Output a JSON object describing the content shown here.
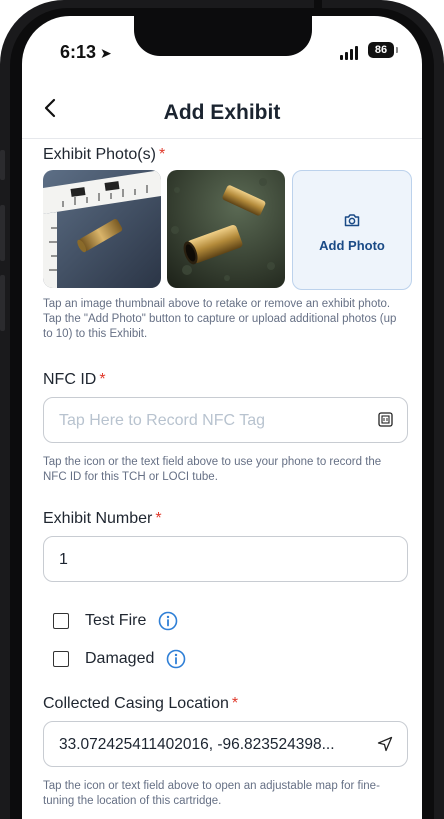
{
  "status": {
    "time": "6:13",
    "battery": "86"
  },
  "header": {
    "title": "Add Exhibit",
    "back_icon": "chevron-left-icon"
  },
  "photos": {
    "label": "Exhibit Photo(s)",
    "required_mark": "*",
    "add_label": "Add Photo",
    "help": "Tap an image thumbnail above to retake or remove an exhibit photo. Tap the \"Add Photo\" button to capture or upload additional photos (up to 10) to this Exhibit."
  },
  "nfc": {
    "label": "NFC ID",
    "required_mark": "*",
    "placeholder": "Tap Here to Record NFC Tag",
    "help": "Tap the icon or the text field above to use your phone to record the NFC ID for this TCH or LOCI tube."
  },
  "exhibit_number": {
    "label": "Exhibit Number",
    "required_mark": "*",
    "value": "1"
  },
  "checkboxes": [
    {
      "label": "Test Fire",
      "checked": false
    },
    {
      "label": "Damaged",
      "checked": false
    }
  ],
  "location": {
    "label": "Collected Casing Location",
    "required_mark": "*",
    "value": "33.072425411402016, -96.823524398...",
    "help": "Tap the icon or text field above to open an adjustable map for fine-tuning the location of this cartridge."
  },
  "colors": {
    "accent": "#1a4a86",
    "required": "#e0392b",
    "info_icon": "#2f7fd6"
  }
}
